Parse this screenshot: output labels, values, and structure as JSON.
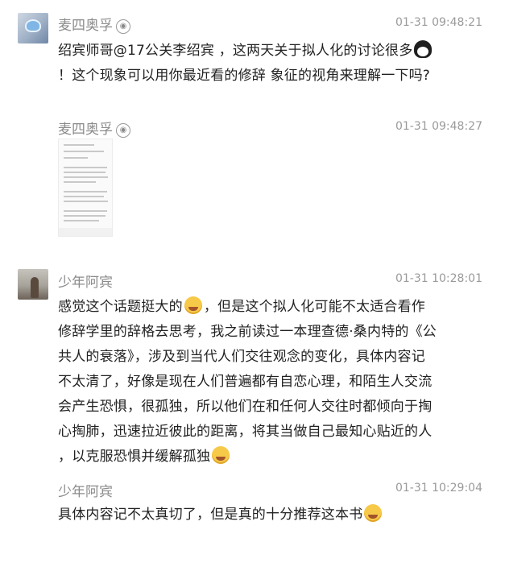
{
  "messages": [
    {
      "user": "麦四奥孚",
      "badge": "🐵",
      "time": "01-31 09:48:21",
      "lines": [
        "绍宾师哥@17公关李绍宾 ，这两天关于拟人化的讨论很多",
        "！这个现象可以用你最近看的修辞 象征的视角来理解一下吗?"
      ],
      "emoji": "penguin-emoji"
    },
    {
      "user": "麦四奥孚",
      "badge": "🐵",
      "time": "01-31 09:48:27",
      "attachment": "screenshot-thumbnail"
    },
    {
      "user": "少年阿宾",
      "time": "01-31 10:28:01",
      "lines": [
        "感觉这个话题挺大的",
        "，但是这个拟人化可能不太适合看作",
        "修辞学里的辞格去思考，我之前读过一本理查德·桑内特的《公",
        "共人的衰落》，涉及到当代人们交往观念的变化，具体内容记",
        "不太清了，好像是现在人们普遍都有自恋心理，和陌生人交流",
        "会产生恐惧，很孤独，所以他们在和任何人交往时都倾向于掏",
        "心掏肺，迅速拉近彼此的距离，将其当做自己最知心贴近的人",
        "，以克服恐惧并缓解孤独"
      ]
    },
    {
      "user": "少年阿宾",
      "time": "01-31 10:29:04",
      "lines": [
        "具体内容记不太真切了，但是真的十分推荐这本书"
      ]
    }
  ]
}
